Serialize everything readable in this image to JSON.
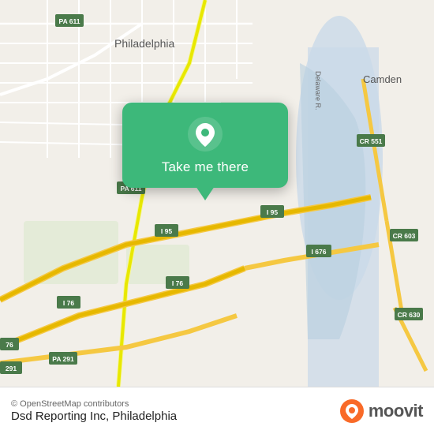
{
  "map": {
    "attribution": "© OpenStreetMap contributors",
    "center_label": "Philadelphia",
    "camden_label": "Camden",
    "route_labels": [
      "PA 611",
      "PA 611",
      "I 95",
      "I 95",
      "I 76",
      "I 76",
      "CR 551",
      "CR 603",
      "CR 630",
      "I 676",
      "PA 291",
      "291",
      "76"
    ]
  },
  "popup": {
    "button_label": "Take me there"
  },
  "bottom_bar": {
    "attribution": "© OpenStreetMap contributors",
    "location_name": "Dsd Reporting Inc, Philadelphia",
    "logo_text": "moovit"
  }
}
